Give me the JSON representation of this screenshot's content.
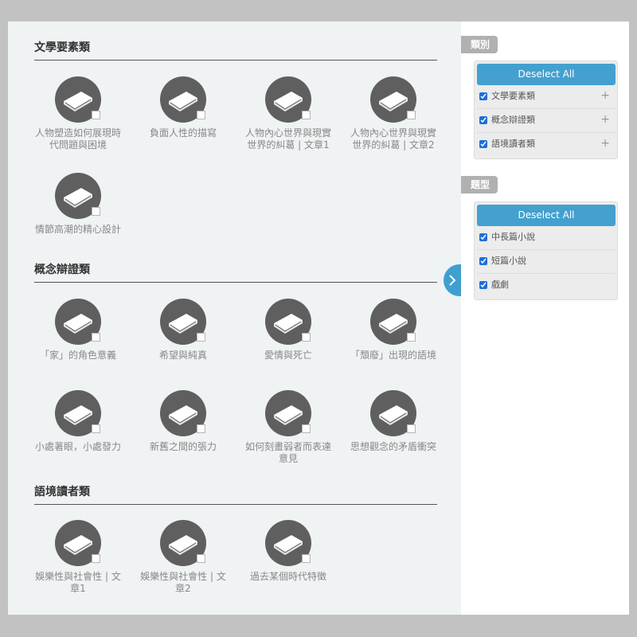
{
  "sections": [
    {
      "title": "文學要素類",
      "items": [
        "人物塑造如何展現時代問題與困境",
        "負面人性的描寫",
        "人物內心世界與現實世界的糾葛 | 文章1",
        "人物內心世界與現實世界的糾葛 | 文章2",
        "情節高潮的精心設計"
      ]
    },
    {
      "title": "概念辯證類",
      "items": [
        "「家」的角色意義",
        "希望與純真",
        "愛情與死亡",
        "「頹廢」出現的語境",
        "小處著眼，小處發力",
        "新舊之間的張力",
        "如何刻畫弱者而表達意見",
        "思想觀念的矛盾衝突"
      ]
    },
    {
      "title": "語境讀者類",
      "items": [
        "娛樂性與社會性 | 文章1",
        "娛樂性與社會性 | 文章2",
        "過去某個時代特徵"
      ]
    }
  ],
  "sidebar": {
    "category_tag": "類別",
    "category_button": "Deselect All",
    "categories": [
      "文學要素類",
      "概念辯證類",
      "語境讀者類"
    ],
    "category_expand": "+",
    "genre_tag": "題型",
    "genre_button": "Deselect All",
    "genres": [
      "中長篇小說",
      "短篇小說",
      "戲劇"
    ]
  },
  "colors": {
    "accent": "#44a0cf",
    "checkbox": "#1f6fd6",
    "icon_circle": "#5f5f5f"
  },
  "icons": {
    "tile": "book-icon",
    "toggle": "chevron-right-icon"
  }
}
